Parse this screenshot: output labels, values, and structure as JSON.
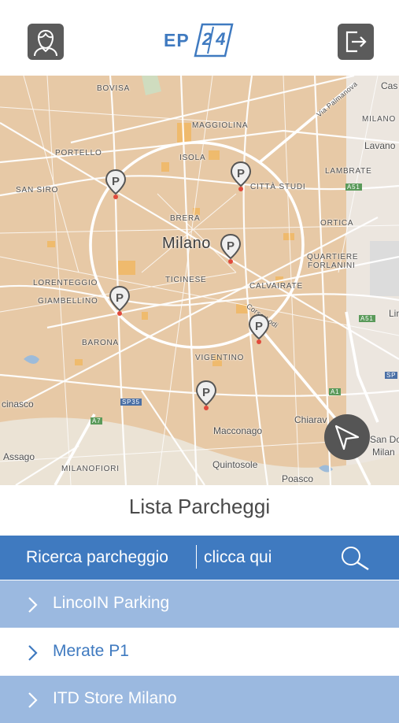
{
  "header": {
    "profile_icon": "user-profile-icon",
    "logo_text": "EP",
    "logo_number": "24",
    "logout_icon": "logout-icon"
  },
  "map": {
    "city": "Milano",
    "districts": [
      "BOVISA",
      "MAGGIOLINA",
      "PORTELLO",
      "ISOLA",
      "LAMBRATE",
      "SAN SIRO",
      "CITTÀ STUDI",
      "BRERA",
      "ORTICA",
      "QUARTIERE",
      "FORLANINI",
      "LORENTEGGIO",
      "TICINESE",
      "CALVAIRATE",
      "GIAMBELLINO",
      "BARONA",
      "VIGENTINO",
      "MILANOFIORI",
      "MILANO"
    ],
    "towns": [
      "Lavano",
      "Cas",
      "Macconago",
      "Quintosole",
      "Chiarav",
      "Assago",
      "cinasco",
      "Poasco",
      "San Do",
      "Milan",
      "Lin"
    ],
    "roads": [
      "Via Palmanova",
      "Corso Lodi",
      "A51",
      "A51",
      "A1",
      "A7",
      "SP35",
      "SP"
    ],
    "nav_icon": "navigation-arrow-icon"
  },
  "list": {
    "title": "Lista Parcheggi",
    "search_label": "Ricerca parcheggio",
    "search_hint": "clicca qui",
    "search_icon": "search-icon",
    "items": [
      {
        "label": "LincoIN Parking"
      },
      {
        "label": "Merate P1"
      },
      {
        "label": "ITD Store Milano"
      }
    ]
  },
  "colors": {
    "brand": "#3f7ac0",
    "row_alt": "#9bb9e0",
    "map_bg": "#e8ccab",
    "icon_bg": "#5b5b5b"
  }
}
